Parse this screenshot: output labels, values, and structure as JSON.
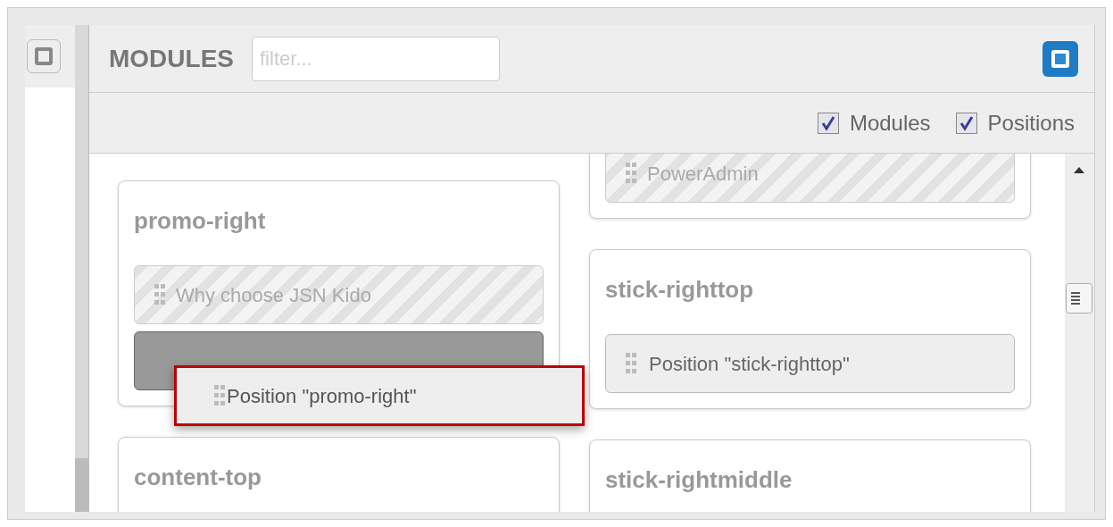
{
  "header": {
    "title": "MODULES",
    "filter": {
      "placeholder": "filter..."
    }
  },
  "toolbar": {
    "checkboxes": [
      {
        "label": "Modules",
        "checked": true
      },
      {
        "label": "Positions",
        "checked": true
      }
    ]
  },
  "columns": [
    {
      "cards": [
        {
          "title": "promo-right",
          "items": [
            {
              "kind": "module",
              "label": "Why choose JSN Kido"
            },
            {
              "kind": "placeholder"
            }
          ]
        },
        {
          "title": "content-top"
        }
      ]
    },
    {
      "cards": [
        {
          "items": [
            {
              "kind": "module",
              "label": "PowerAdmin"
            }
          ]
        },
        {
          "title": "stick-righttop",
          "items": [
            {
              "kind": "position",
              "label": "Position \"stick-righttop\""
            }
          ]
        },
        {
          "title": "stick-rightmiddle"
        }
      ]
    }
  ],
  "dragging_item": {
    "label": "Position \"promo-right\"",
    "highlighted": true
  }
}
